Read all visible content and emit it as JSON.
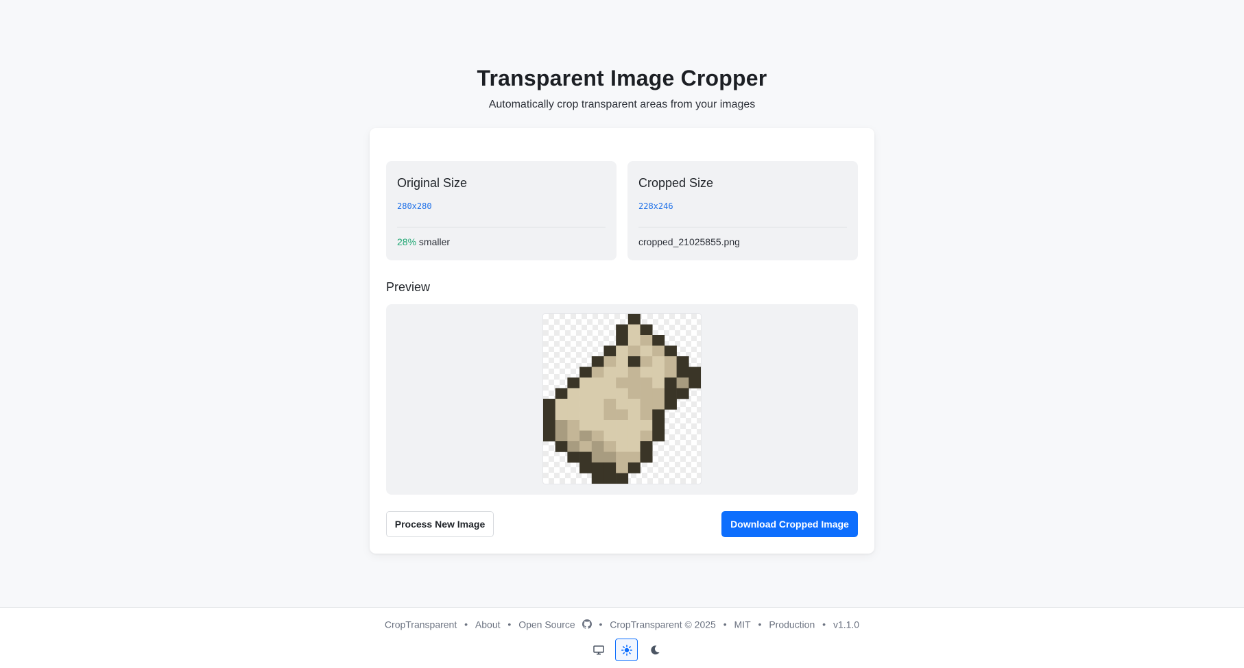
{
  "header": {
    "title": "Transparent Image Cropper",
    "subtitle": "Automatically crop transparent areas from your images"
  },
  "original": {
    "heading": "Original Size",
    "dimensions": "280x280",
    "reduction_percent": "28%",
    "reduction_suffix": "smaller"
  },
  "cropped": {
    "heading": "Cropped Size",
    "dimensions": "228x246",
    "filename": "cropped_21025855.png"
  },
  "preview": {
    "heading": "Preview"
  },
  "actions": {
    "process_new": "Process New Image",
    "download": "Download Cropped Image"
  },
  "footer": {
    "links": [
      "CropTransparent",
      "About",
      "Open Source",
      "CropTransparent © 2025",
      "MIT",
      "Production",
      "v1.1.0"
    ],
    "separator": "•"
  },
  "theme": {
    "options": [
      "monitor-icon",
      "sun-icon",
      "moon-icon"
    ],
    "active": "sun-icon"
  },
  "colors": {
    "accent": "#0d6efd",
    "success": "#1ea672",
    "outline": "#3a3527",
    "fill_light": "#d8ccad",
    "fill_mid": "#c4b697",
    "fill_dark": "#a89c80"
  }
}
